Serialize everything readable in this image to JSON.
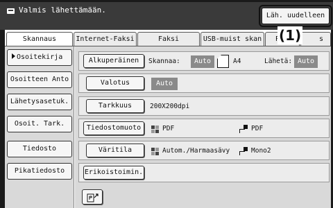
{
  "status": {
    "message": "Valmis lähettämään.",
    "resend_label": "Läh. uudelleen",
    "callout": "(1)"
  },
  "tabs": [
    {
      "label": "Skannaus",
      "active": true
    },
    {
      "label": "Internet-Faksi",
      "active": false
    },
    {
      "label": "Faksi",
      "active": false
    },
    {
      "label": "USB-muist skan",
      "active": false
    },
    {
      "label": "PC",
      "active": false
    },
    {
      "label": "s",
      "active": false
    }
  ],
  "sidebar": {
    "items": [
      {
        "label": "Osoitekirja",
        "selected": true
      },
      {
        "label": "Osoitteen Anto",
        "selected": false
      },
      {
        "label": "Lähetysasetuk.",
        "selected": false
      },
      {
        "label": "Osoit. Tark.",
        "selected": false
      },
      {
        "label": "Tiedosto",
        "selected": false
      },
      {
        "label": "Pikatiedosto",
        "selected": false
      }
    ]
  },
  "settings": {
    "original": {
      "button": "Alkuperäinen",
      "scan_label": "Skannaa:",
      "scan_value": "Auto",
      "size": "A4",
      "send_label": "Lähetä:",
      "send_value": "Auto"
    },
    "exposure": {
      "button": "Valotus",
      "value": "Auto"
    },
    "resolution": {
      "button": "Tarkkuus",
      "value": "200X200dpi"
    },
    "file_format": {
      "button": "Tiedostomuoto",
      "color_value": "PDF",
      "bw_value": "PDF"
    },
    "color_mode": {
      "button": "Väritila",
      "color_value": "Autom./Harmaasävy",
      "bw_value": "Mono2"
    },
    "special": {
      "button": "Erikoistoimin."
    }
  },
  "colors": {
    "status_bar": "#3a3a3a",
    "panel_bg": "#d9d9d9",
    "value_box": "#8a8a8a"
  }
}
